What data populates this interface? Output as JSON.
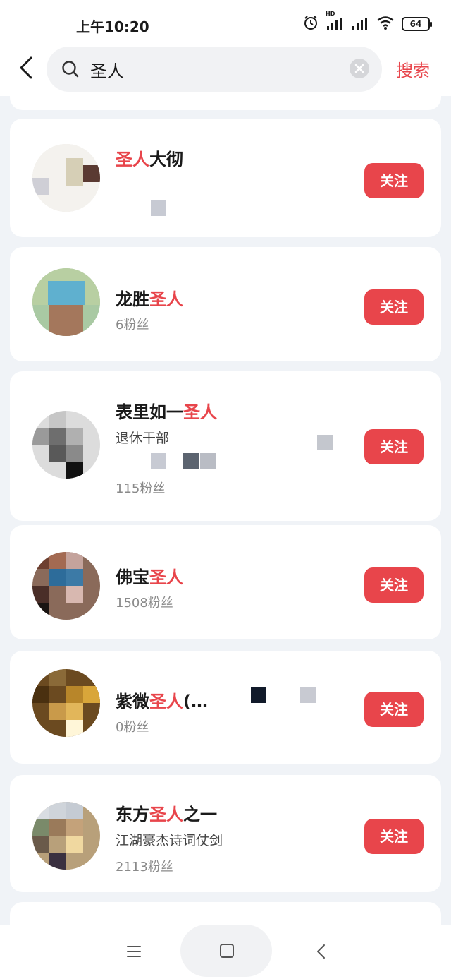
{
  "status_bar": {
    "time": "上午10:20",
    "signal_label": "HD",
    "battery": "64"
  },
  "header": {
    "search_value": "圣人",
    "search_button": "搜索"
  },
  "results": [
    {
      "name_highlight": "圣人",
      "name_rest": "大彻",
      "name_suffix": "",
      "desc": "",
      "fans": "",
      "follow": "关注"
    },
    {
      "name_prefix": "龙胜",
      "name_highlight": "圣人",
      "fans": "6粉丝",
      "follow": "关注"
    },
    {
      "name_prefix": "表里如一",
      "name_highlight": "圣人",
      "desc": "退休干部",
      "fans": "115粉丝",
      "follow": "关注"
    },
    {
      "name_prefix": "佛宝",
      "name_highlight": "圣人",
      "fans": "1508粉丝",
      "follow": "关注"
    },
    {
      "name_prefix": "紫微",
      "name_highlight": "圣人",
      "name_rest": "(…",
      "fans": "0粉丝",
      "follow": "关注"
    },
    {
      "name_prefix": "东方",
      "name_highlight": "圣人",
      "name_rest": "之一",
      "desc": "江湖豪杰诗词仗剑",
      "fans": "2113粉丝",
      "follow": "关注"
    }
  ],
  "colors": {
    "accent": "#e8454b",
    "background": "#f0f3f7"
  },
  "icons": {
    "back": "chevron-left-icon",
    "search": "search-icon",
    "clear": "close-circle-icon",
    "nav_menu": "menu-icon",
    "nav_home": "square-icon",
    "nav_back": "chevron-left-icon"
  }
}
